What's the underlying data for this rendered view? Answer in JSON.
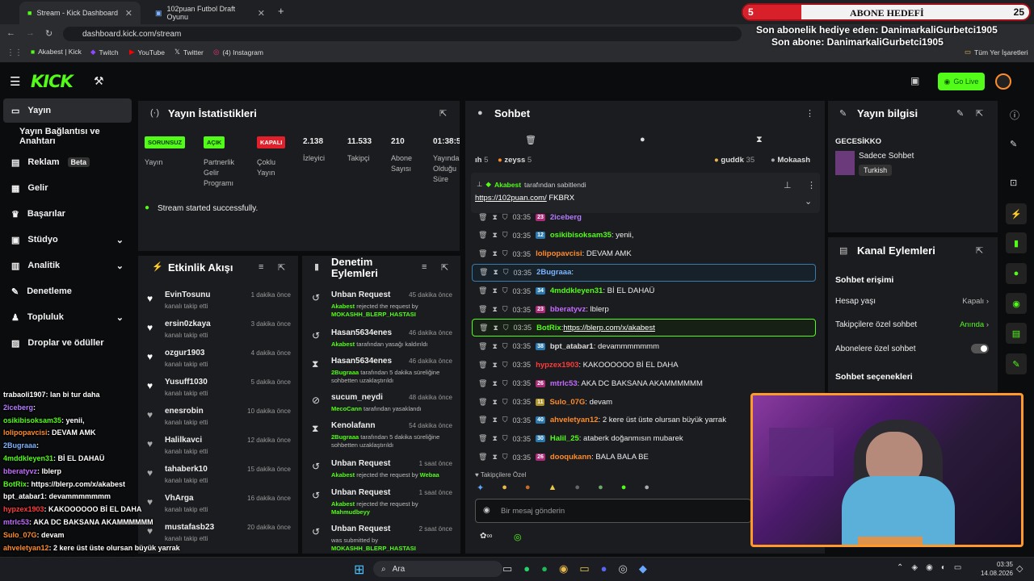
{
  "browser": {
    "tabs": [
      {
        "label": "Stream - Kick Dashboard"
      },
      {
        "label": "102puan Futbol Draft Oyunu"
      }
    ],
    "url": "dashboard.kick.com/stream",
    "bookmarks": [
      {
        "label": "Akabest | Kick"
      },
      {
        "label": "Twitch"
      },
      {
        "label": "YouTube"
      },
      {
        "label": "Twitter"
      },
      {
        "label": "(4) Instagram"
      }
    ],
    "all_bookmarks": "Tüm Yer İşaretleri"
  },
  "overlay": {
    "sub_goal_label": "ABONE HEDEFİ",
    "sub_goal_current": "5",
    "sub_goal_target": "25",
    "last_gift": "Son abonelik hediye eden: DanimarkaliGurbetci1905",
    "last_sub": "Son abone: DanimarkaliGurbetci1905"
  },
  "topnav": {
    "logo": "KICK",
    "go_live": "Go Live"
  },
  "sidebar": {
    "items": [
      {
        "label": "Yayın"
      },
      {
        "label": "Yayın Bağlantısı ve Anahtarı"
      },
      {
        "label": "Reklam",
        "badge": "Beta"
      },
      {
        "label": "Gelir"
      },
      {
        "label": "Başarılar"
      },
      {
        "label": "Stüdyo"
      },
      {
        "label": "Analitik"
      },
      {
        "label": "Denetleme"
      },
      {
        "label": "Topluluk"
      },
      {
        "label": "Droplar ve ödüller"
      }
    ]
  },
  "stats": {
    "title": "Yayın İstatistikleri",
    "badges": [
      {
        "label": "SORUNSUZ",
        "caption": "Yayın"
      },
      {
        "label": "AÇIK",
        "caption": "Partnerlik Gelir Programı"
      },
      {
        "label": "KAPALI",
        "caption": "Çoklu Yayın"
      }
    ],
    "numbers": [
      {
        "value": "2.138",
        "caption": "İzleyici"
      },
      {
        "value": "11.533",
        "caption": "Takipçi"
      },
      {
        "value": "210",
        "caption": "Abone Sayısı"
      },
      {
        "value": "01:38:5",
        "caption": "Yayında Olduğu Süre"
      }
    ],
    "status_message": "Stream started successfully."
  },
  "activity": {
    "title": "Etkinlik Akışı",
    "items": [
      {
        "name": "EvinTosunu",
        "sub": "kanalı takip etti",
        "time": "1 dakika önce"
      },
      {
        "name": "ersin0zkaya",
        "sub": "kanalı takip etti",
        "time": "3 dakika önce"
      },
      {
        "name": "ozgur1903",
        "sub": "kanalı takip etti",
        "time": "4 dakika önce"
      },
      {
        "name": "Yusuff1030",
        "sub": "kanalı takip etti",
        "time": "5 dakika önce"
      },
      {
        "name": "enesrobin",
        "sub": "kanalı takip etti",
        "time": "10 dakika önce"
      },
      {
        "name": "Halilkavci",
        "sub": "kanalı takip etti",
        "time": "12 dakika önce"
      },
      {
        "name": "tahaberk10",
        "sub": "kanalı takip etti",
        "time": "15 dakika önce"
      },
      {
        "name": "VhArga",
        "sub": "kanalı takip etti",
        "time": "16 dakika önce"
      },
      {
        "name": "mustafasb23",
        "sub": "kanalı takip etti",
        "time": "20 dakika önce"
      }
    ]
  },
  "moderation": {
    "title": "Denetim Eylemleri",
    "items": [
      {
        "title": "Unban Request",
        "time": "45 dakika önce",
        "actor": "Akabest",
        "text": "rejected the request by",
        "target": "MOKASHH_BLERP_HASTASI"
      },
      {
        "title": "Hasan5634enes",
        "time": "46 dakika önce",
        "actor": "Akabest",
        "text": "tarafından yasağı kaldırıldı",
        "target": ""
      },
      {
        "title": "Hasan5634enes",
        "time": "46 dakika önce",
        "actor": "2Bugraaa",
        "text": "tarafından 5 dakika süreliğine sohbetten uzaklaştırıldı",
        "target": ""
      },
      {
        "title": "sucum_neydi",
        "time": "48 dakika önce",
        "actor": "MecoCann",
        "text": "tarafından yasaklandı",
        "target": ""
      },
      {
        "title": "Kenolafann",
        "time": "54 dakika önce",
        "actor": "2Bugraaa",
        "text": "tarafından 5 dakika süreliğine sohbetten uzaklaştırıldı",
        "target": ""
      },
      {
        "title": "Unban Request",
        "time": "1 saat önce",
        "actor": "Akabest",
        "text": "rejected the request by",
        "target": "Webaa"
      },
      {
        "title": "Unban Request",
        "time": "1 saat önce",
        "actor": "Akabest",
        "text": "rejected the request by",
        "target": "Mahmudbeyy"
      },
      {
        "title": "Unban Request",
        "time": "2 saat önce",
        "actor": "",
        "text": "was submitted by",
        "target": "MOKASHH_BLERP_HASTASI"
      }
    ]
  },
  "chat": {
    "title": "Sohbet",
    "leaderboard": [
      {
        "name": "ıh",
        "count": "5"
      },
      {
        "name": "zeyss",
        "count": "5"
      },
      {
        "name": "guddk",
        "count": "35"
      },
      {
        "name": "Mokaash",
        "count": ""
      }
    ],
    "pinned": {
      "by": "Akabest",
      "by_suffix": "tarafından sabitlendi",
      "link": "https://102puan.com/",
      "text": "FKBRX"
    },
    "messages": [
      {
        "time": "03:35",
        "user": "2iceberg",
        "text": "",
        "color": "#b47cff",
        "sub": "23",
        "subc": "#b02a7a"
      },
      {
        "time": "03:35",
        "user": "osikibisoksam35",
        "text": ": yenii,",
        "color": "#53fc18",
        "sub": "12",
        "subc": "#2a7ab0"
      },
      {
        "time": "03:35",
        "user": "lolipopavcisi",
        "text": ": DEVAM AMK",
        "color": "#ff8c2a",
        "sub": "",
        "subc": ""
      },
      {
        "time": "03:35",
        "user": "2Bugraaa",
        "text": ":",
        "color": "#7cb4ff",
        "sub": "",
        "subc": ""
      },
      {
        "time": "03:35",
        "user": "4mddkleyen31",
        "text": ": Bİ EL DAHAÜ",
        "color": "#53fc18",
        "sub": "34",
        "subc": "#2a7ab0"
      },
      {
        "time": "03:35",
        "user": "bberatyvz",
        "text": ": lblerp",
        "color": "#c46bff",
        "sub": "23",
        "subc": "#b02a7a"
      },
      {
        "time": "03:35",
        "user": "BotRix",
        "text": ": ",
        "link": "https://blerp.com/x/akabest",
        "color": "#53fc18",
        "sub": "",
        "subc": ""
      },
      {
        "time": "03:35",
        "user": "bpt_atabar1",
        "text": ": devammmmmmm",
        "color": "#dddddd",
        "sub": "38",
        "subc": "#2a7ab0"
      },
      {
        "time": "03:35",
        "user": "hypzex1903",
        "text": ": KAKOOOOOO Bİ EL DAHA",
        "color": "#ff3b3b",
        "sub": "",
        "subc": ""
      },
      {
        "time": "03:35",
        "user": "mtrlc53",
        "text": ": AKA DC BAKSANA AKAMMMMMM",
        "color": "#c46bff",
        "sub": "26",
        "subc": "#b02a7a"
      },
      {
        "time": "03:35",
        "user": "Sulo_07G",
        "text": ": devam",
        "color": "#ff8c2a",
        "sub": "11",
        "subc": "#b0962a"
      },
      {
        "time": "03:35",
        "user": "ahveletyan12",
        "text": ": 2 kere üst üste olursan büyük yarrak",
        "color": "#ff8c2a",
        "sub": "40",
        "subc": "#2a7ab0"
      },
      {
        "time": "03:35",
        "user": "Halil_25",
        "text": ": ataberk doğanmısın mubarek",
        "color": "#53fc18",
        "sub": "30",
        "subc": "#2a7ab0"
      },
      {
        "time": "03:35",
        "user": "dooqukann",
        "text": ": BALA BALA BE",
        "color": "#ff8c2a",
        "sub": "26",
        "subc": "#b02a7a"
      }
    ],
    "followers_only": "Takipçilere Özel",
    "input_placeholder": "Bir mesaj gönderin"
  },
  "stream_info": {
    "title": "Yayın bilgisi",
    "stream_title": "GECESİKKO",
    "category": "Sadece Sohbet",
    "tag": "Turkish"
  },
  "channel_actions": {
    "title": "Kanal Eylemleri",
    "section": "Sohbet erişimi",
    "rows": [
      {
        "label": "Hesap yaşı",
        "value": "Kapalı"
      },
      {
        "label": "Takipçilere özel sohbet",
        "value": "Anında"
      },
      {
        "label": "Abonelere özel sohbet",
        "value": ""
      }
    ],
    "section2": "Sohbet seçenekleri"
  },
  "overlay_chat": [
    {
      "user": "trabaoli1907",
      "text": ": lan bi tur daha",
      "color": "#ffffff"
    },
    {
      "user": "2iceberg",
      "text": ":",
      "color": "#b47cff"
    },
    {
      "user": "osikibisoksam35",
      "text": ": yenii,",
      "color": "#53fc18"
    },
    {
      "user": "lolipopavcisi",
      "text": ": DEVAM AMK",
      "color": "#ff8c2a"
    },
    {
      "user": "2Bugraaa",
      "text": ":",
      "color": "#7cb4ff"
    },
    {
      "user": "4mddkleyen31",
      "text": ": Bİ EL DAHAÜ",
      "color": "#53fc18"
    },
    {
      "user": "bberatyvz",
      "text": ": lblerp",
      "color": "#c46bff"
    },
    {
      "user": "BotRix",
      "text": ": https://blerp.com/x/akabest",
      "color": "#53fc18"
    },
    {
      "user": "bpt_atabar1",
      "text": ": devammmmmmm",
      "color": "#ffffff"
    },
    {
      "user": "hypzex1903",
      "text": ": KAKOOOOOO Bİ EL DAHA",
      "color": "#ff3b3b"
    },
    {
      "user": "mtrlc53",
      "text": ": AKA DC BAKSANA AKAMMMMMM",
      "color": "#c46bff"
    },
    {
      "user": "Sulo_07G",
      "text": ": devam",
      "color": "#ff8c2a"
    },
    {
      "user": "ahveletyan12",
      "text": ": 2 kere üst üste olursan büyük yarrak",
      "color": "#ff8c2a"
    },
    {
      "user": "Halil_25",
      "text": ": ataberk doğanmısın mubarek",
      "color": "#53fc18"
    },
    {
      "user": "dooqukann",
      "text": ": BALA BALA BE",
      "color": "#ff8c2a"
    }
  ],
  "taskbar": {
    "search": "Ara",
    "time": "03:35",
    "date": "14.08.2026"
  },
  "colors": {
    "accent": "#53fc18",
    "panel": "#1b1c1f",
    "bg": "#0b0c0e",
    "danger": "#e0202a"
  }
}
